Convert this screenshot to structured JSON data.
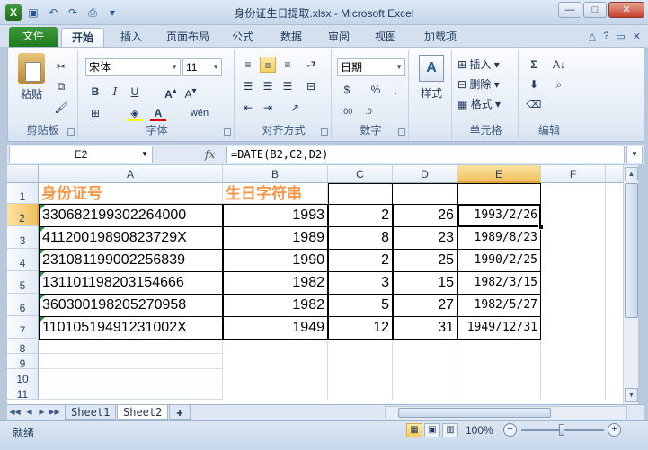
{
  "window": {
    "title": "身份证生日提取.xlsx  -  Microsoft Excel",
    "app_icon": "X",
    "controls": [
      "—",
      "□",
      "✕"
    ]
  },
  "quick_access": [
    "save-icon",
    "undo-icon",
    "redo-icon",
    "print-preview-icon"
  ],
  "ribbon_tabs": [
    {
      "label": "文件"
    },
    {
      "label": "开始"
    },
    {
      "label": "插入"
    },
    {
      "label": "页面布局"
    },
    {
      "label": "公式"
    },
    {
      "label": "数据"
    },
    {
      "label": "审阅"
    },
    {
      "label": "视图"
    },
    {
      "label": "加载项"
    }
  ],
  "ribbon": {
    "clipboard": {
      "label": "剪贴板",
      "paste": "粘贴"
    },
    "font": {
      "label": "字体",
      "name": "宋体",
      "size": "11",
      "bold": "B",
      "italic": "I",
      "underline": "U",
      "phonetic": "wén"
    },
    "alignment": {
      "label": "对齐方式"
    },
    "number": {
      "label": "数字",
      "format": "日期",
      "percent": "%"
    },
    "styles": {
      "label": "样式"
    },
    "cells": {
      "label": "单元格",
      "insert": "插入",
      "delete": "删除",
      "format": "格式"
    },
    "editing": {
      "label": "编辑"
    }
  },
  "formula_bar": {
    "name_box": "E2",
    "fx": "fx",
    "formula": "=DATE(B2,C2,D2)"
  },
  "columns": [
    "A",
    "B",
    "C",
    "D",
    "E",
    "F"
  ],
  "rows": [
    "1",
    "2",
    "3",
    "4",
    "5",
    "6",
    "7",
    "8",
    "9",
    "10",
    "11"
  ],
  "sheet": {
    "headers": {
      "A": "身份证号",
      "B": "生日字符串"
    },
    "data": [
      {
        "A": "330682199302264000",
        "B": "1993",
        "C": "2",
        "D": "26",
        "E": "1993/2/26"
      },
      {
        "A": "41120019890823729X",
        "B": "1989",
        "C": "8",
        "D": "23",
        "E": "1989/8/23"
      },
      {
        "A": "231081199002256839",
        "B": "1990",
        "C": "2",
        "D": "25",
        "E": "1990/2/25"
      },
      {
        "A": "131101198203154666",
        "B": "1982",
        "C": "3",
        "D": "15",
        "E": "1982/3/15"
      },
      {
        "A": "360300198205270958",
        "B": "1982",
        "C": "5",
        "D": "27",
        "E": "1982/5/27"
      },
      {
        "A": "11010519491231002X",
        "B": "1949",
        "C": "12",
        "D": "31",
        "E": "1949/12/31"
      }
    ]
  },
  "sheet_tabs": [
    {
      "label": "Sheet1"
    },
    {
      "label": "Sheet2"
    }
  ],
  "status": {
    "ready": "就绪",
    "zoom": "100%"
  }
}
